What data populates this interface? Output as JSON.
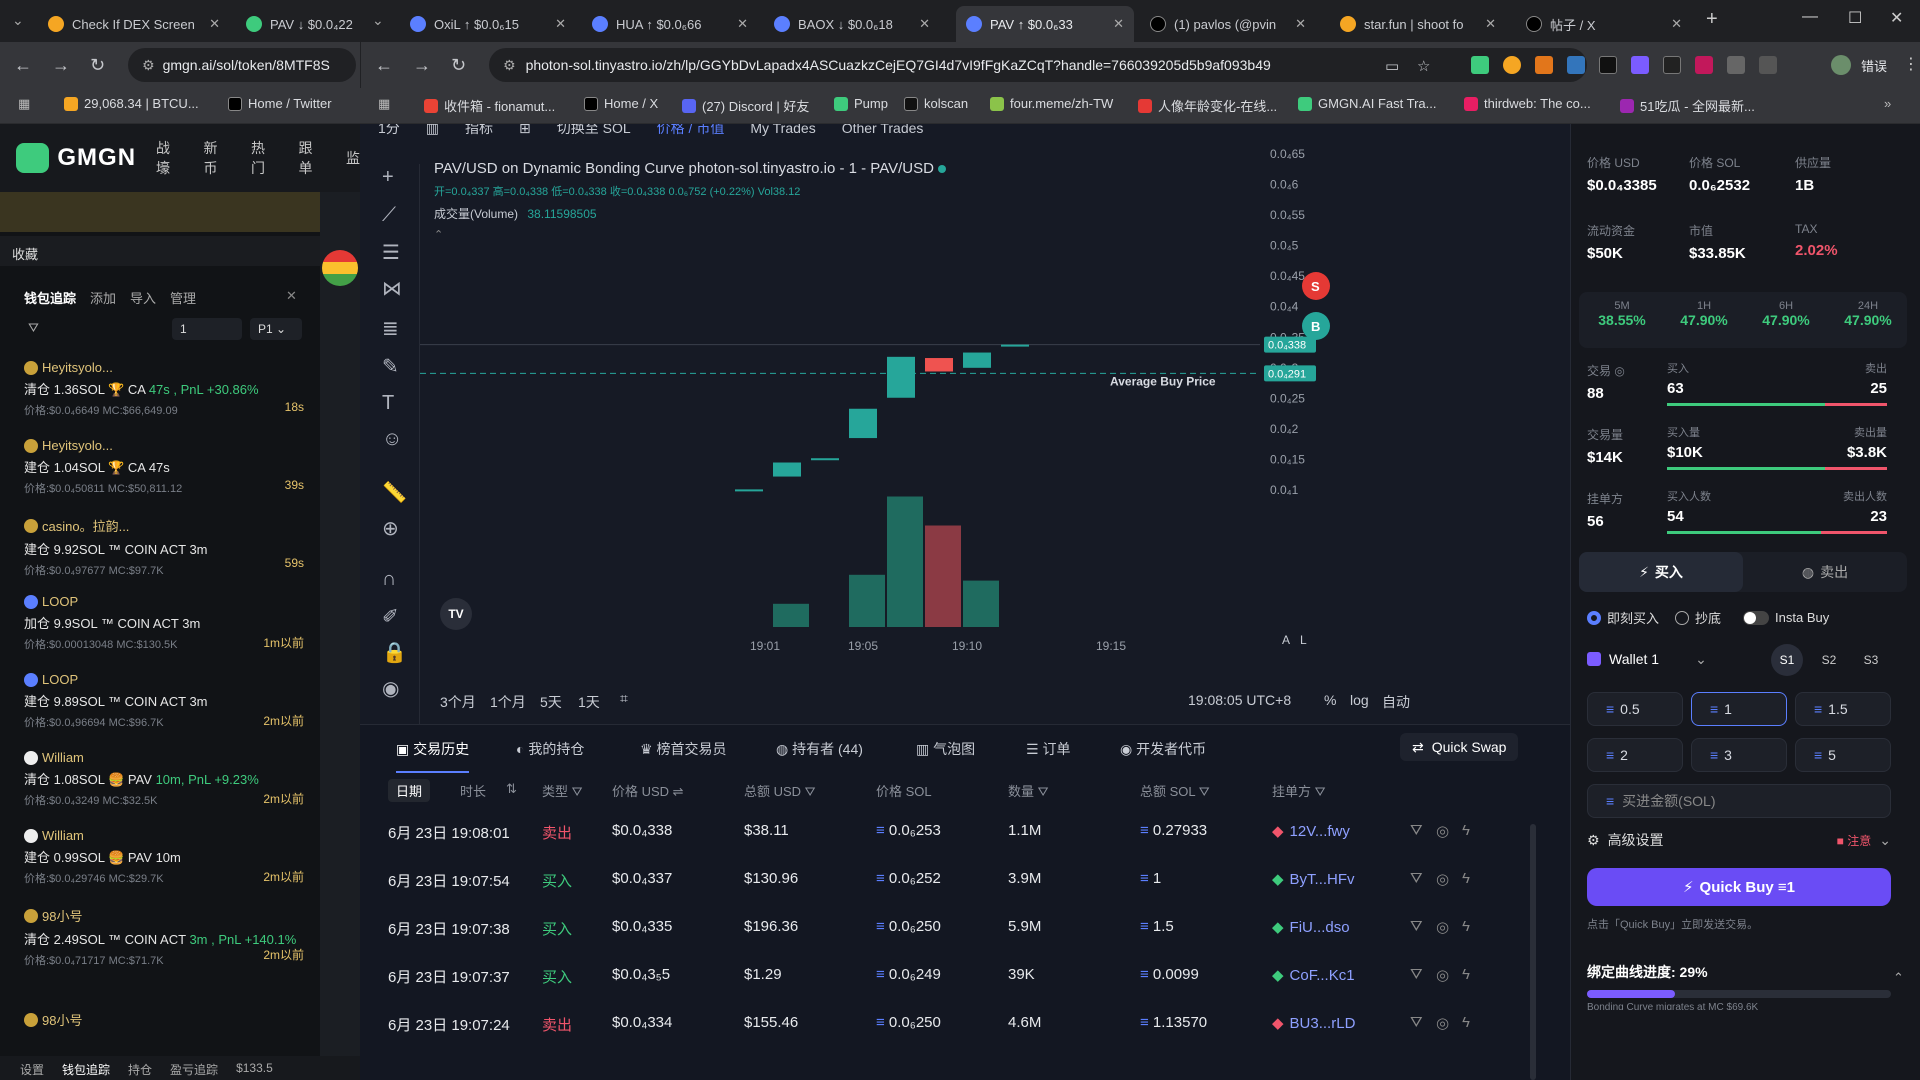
{
  "browser": {
    "tabs": [
      {
        "label": "Check If DEX Screen",
        "color": "#f5a623"
      },
      {
        "label": "PAV ↓ $0.0₄22",
        "color": "#3ecb7d"
      },
      {
        "label": "OxiL ↑ $0.0₆15",
        "color": "#5b7fff"
      },
      {
        "label": "HUA ↑ $0.0₆66",
        "color": "#5b7fff"
      },
      {
        "label": "BAOX ↓ $0.0₆18",
        "color": "#5b7fff"
      },
      {
        "label": "PAV ↑ $0.0₆33",
        "color": "#5b7fff"
      },
      {
        "label": "(1) pavlos (@pvin",
        "color": "#000000"
      },
      {
        "label": "star.fun | shoot fo",
        "color": "#f5a623"
      },
      {
        "label": "帖子 / X",
        "color": "#000000"
      }
    ],
    "url_left": "gmgn.ai/sol/token/8MTF8S",
    "url_right": "photon-sol.tinyastro.io/zh/lp/GGYbDvLapadx4ASCuazkzCejEQ7GI4d7vI9fFgKaZCqT?handle=766039205d5b9af093b49",
    "bookmarks_left": [
      "29,068.34 | BTCU...",
      "Home / Twitter"
    ],
    "bookmarks_right": [
      "收件箱 - fionamut...",
      "Home / X",
      "(27) Discord | 好友",
      "Pump",
      "kolscan",
      "four.meme/zh-TW",
      "人像年龄变化-在线...",
      "GMGN.AI Fast Tra...",
      "thirdweb: The co...",
      "51吃瓜 - 全网最新..."
    ],
    "profile_btn": "错误"
  },
  "gmgn": {
    "logo": "GMGN",
    "nav": [
      "战壕",
      "新币",
      "热门",
      "跟单",
      "监"
    ],
    "fav_label": "收藏",
    "wallet_tabs": [
      "钱包追踪",
      "添加",
      "导入",
      "管理"
    ],
    "filter_count": "1",
    "filter_p": "P1",
    "feed": [
      {
        "name": "Heyitsyolo...",
        "action": "清仓 1.36SOL 🏆 CA",
        "extra": "47s , PnL +30.86%",
        "price": "价格:$0.0₄6649 MC:$66,649.09",
        "time": "18s"
      },
      {
        "name": "Heyitsyolo...",
        "action": "建仓 1.04SOL 🏆 CA",
        "extra": "47s",
        "price": "价格:$0.0₄50811 MC:$50,811.12",
        "time": "39s"
      },
      {
        "name": "casino。拉韵...",
        "action": "建仓 9.92SOL ™ COIN ACT",
        "extra": "3m",
        "price": "价格:$0.0₄97677 MC:$97.7K",
        "time": "59s"
      },
      {
        "name": "LOOP",
        "action": "加仓 9.9SOL ™ COIN ACT",
        "extra": "3m",
        "price": "价格:$0.00013048 MC:$130.5K",
        "time": "1m以前"
      },
      {
        "name": "LOOP",
        "action": "建仓 9.89SOL ™ COIN ACT",
        "extra": "3m",
        "price": "价格:$0.0₄96694 MC:$96.7K",
        "time": "2m以前"
      },
      {
        "name": "William",
        "action": "清仓 1.08SOL 🍔 PAV",
        "extra": "10m, PnL +9.23%",
        "price": "价格:$0.0₄3249 MC:$32.5K",
        "time": "2m以前"
      },
      {
        "name": "William",
        "action": "建仓 0.99SOL 🍔 PAV",
        "extra": "10m",
        "price": "价格:$0.0₄29746 MC:$29.7K",
        "time": "2m以前"
      },
      {
        "name": "98小号",
        "action": "清仓 2.49SOL ™ COIN ACT",
        "extra": "3m , PnL +140.1%",
        "price": "价格:$0.0₄71717 MC:$71.7K",
        "time": "2m以前"
      },
      {
        "name": "98小号",
        "action": "",
        "extra": "",
        "price": "",
        "time": ""
      }
    ],
    "bottom": [
      "设置",
      "钱包追踪",
      "持仓",
      "盈亏追踪",
      "$133.5"
    ]
  },
  "chart": {
    "toolbar": [
      "1分",
      "指标",
      "切换至 SOL",
      "价格 / 市值",
      "My Trades",
      "Other Trades"
    ],
    "title": "PAV/USD on Dynamic Bonding Curve photon-sol.tinyastro.io - 1 - PAV/USD",
    "ohlc": "开=0.0₄337 高=0.0₄338 低=0.0₄338 收=0.0₄338 0.0₆752 (+0.22%) Vol38.12",
    "volume_label": "成交量(Volume)",
    "volume_value": "38.11598505",
    "price_ticks": [
      "0.0₄65",
      "0.0₄6",
      "0.0₄55",
      "0.0₄5",
      "0.0₄45",
      "0.0₄4",
      "0.0₄35",
      "0.0₄3",
      "0.0₄25",
      "0.0₄2",
      "0.0₄15",
      "0.0₄1"
    ],
    "last_price": "0.0₄338",
    "avg_price": "0.0₄291",
    "avg_label": "Average Buy Price",
    "time_ticks": [
      "19:01",
      "19:05",
      "19:10",
      "19:15"
    ],
    "ranges": [
      "3个月",
      "1个月",
      "5天",
      "1天"
    ],
    "clock": "19:08:05 UTC+8",
    "right_opts": [
      "%",
      "log",
      "自动"
    ],
    "marker_sell": "S",
    "marker_buy": "B",
    "axis_btns": [
      "A",
      "L"
    ]
  },
  "chart_data": {
    "type": "candlestick",
    "candles": [
      {
        "o": 1.01e-05,
        "c": 1.01e-05,
        "v": 0
      },
      {
        "o": 1.22e-05,
        "c": 1.45e-05,
        "v": 8
      },
      {
        "o": 1.52e-05,
        "c": 1.52e-05,
        "v": 0
      },
      {
        "o": 1.85e-05,
        "c": 2.33e-05,
        "v": 18
      },
      {
        "o": 2.51e-05,
        "c": 3.18e-05,
        "v": 45
      },
      {
        "o": 3.16e-05,
        "c": 2.94e-05,
        "v": 35
      },
      {
        "o": 3e-05,
        "c": 3.25e-05,
        "v": 16
      },
      {
        "o": 3.38e-05,
        "c": 3.38e-05,
        "v": 0
      }
    ]
  },
  "tradetabs": {
    "tabs": [
      "交易历史",
      "我的持仓",
      "榜首交易员",
      "持有者 (44)",
      "气泡图",
      "订单",
      "开发者代币"
    ],
    "quick_swap": "Quick Swap"
  },
  "table": {
    "headers": [
      "日期",
      "时长",
      "类型",
      "价格 USD",
      "总额 USD",
      "价格 SOL",
      "数量",
      "总额 SOL",
      "挂单方"
    ],
    "rows": [
      {
        "date": "6月 23日 19:08:01",
        "type": "卖出",
        "price": "$0.0₄338",
        "usd": "$38.11",
        "sol": "0.0₆253",
        "qty": "1.1M",
        "total": "0.27933",
        "maker": "12V...fwy",
        "side": "sell"
      },
      {
        "date": "6月 23日 19:07:54",
        "type": "买入",
        "price": "$0.0₄337",
        "usd": "$130.96",
        "sol": "0.0₆252",
        "qty": "3.9M",
        "total": "1",
        "maker": "ByT...HFv",
        "side": "buy"
      },
      {
        "date": "6月 23日 19:07:38",
        "type": "买入",
        "price": "$0.0₄335",
        "usd": "$196.36",
        "sol": "0.0₆250",
        "qty": "5.9M",
        "total": "1.5",
        "maker": "FiU...dso",
        "side": "buy"
      },
      {
        "date": "6月 23日 19:07:37",
        "type": "买入",
        "price": "$0.0₄3₅5",
        "usd": "$1.29",
        "sol": "0.0₆249",
        "qty": "39K",
        "total": "0.0099",
        "maker": "CoF...Kc1",
        "side": "buy"
      },
      {
        "date": "6月 23日 19:07:24",
        "type": "卖出",
        "price": "$0.0₄334",
        "usd": "$155.46",
        "sol": "0.0₆250",
        "qty": "4.6M",
        "total": "1.13570",
        "maker": "BU3...rLD",
        "side": "sell"
      }
    ]
  },
  "panel": {
    "stats1": [
      {
        "l": "价格 USD",
        "v": "$0.0₄3385"
      },
      {
        "l": "价格 SOL",
        "v": "0.0₆2532"
      },
      {
        "l": "供应量",
        "v": "1B"
      },
      {
        "l": "流动资金",
        "v": "$50K"
      },
      {
        "l": "市值",
        "v": "$33.85K"
      },
      {
        "l": "TAX",
        "v": "2.02%"
      }
    ],
    "periods": [
      {
        "l": "5M",
        "v": "38.55%"
      },
      {
        "l": "1H",
        "v": "47.90%"
      },
      {
        "l": "6H",
        "v": "47.90%"
      },
      {
        "l": "24H",
        "v": "47.90%"
      }
    ],
    "txn": {
      "l": "交易 ◎",
      "v": "88",
      "buys_l": "买入",
      "buys": "63",
      "sells_l": "卖出",
      "sells": "25"
    },
    "vol": {
      "l": "交易量",
      "v": "$14K",
      "bv_l": "买入量",
      "bv": "$10K",
      "sv_l": "卖出量",
      "sv": "$3.8K"
    },
    "makers": {
      "l": "挂单方",
      "v": "56",
      "bm_l": "买入人数",
      "bm": "54",
      "sm_l": "卖出人数",
      "sm": "23"
    },
    "buy_tab": "买入",
    "sell_tab": "卖出",
    "mode_instant": "即刻买入",
    "mode_limit": "抄底",
    "insta_buy": "Insta Buy",
    "wallet": "Wallet 1",
    "slots": [
      "S1",
      "S2",
      "S3"
    ],
    "amounts": [
      "0.5",
      "1",
      "1.5",
      "2",
      "3",
      "5"
    ],
    "amount_placeholder": "买进金额(SOL)",
    "advanced": "高级设置",
    "adv_note": "注意",
    "quick_buy": "Quick Buy ≡1",
    "hint": "点击「Quick Buy」立即发送交易。",
    "bonding_label": "绑定曲线进度: 29%",
    "bonding_progress": 0.29,
    "bonding_sub": "Bonding Curve migrates at MC $69.6K"
  }
}
